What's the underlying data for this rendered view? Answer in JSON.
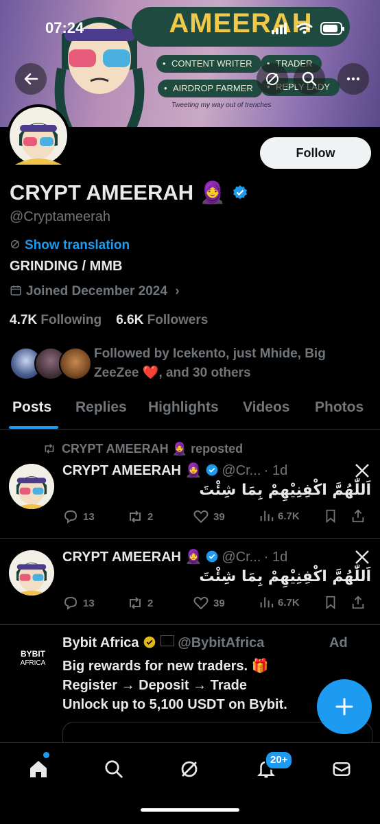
{
  "status": {
    "time": "07:24"
  },
  "banner": {
    "title": "AMEERAH",
    "tags": [
      "CONTENT WRITER",
      "TRADER",
      "AIRDROP FARMER",
      "REPLY LADY"
    ],
    "tagline": "Tweeting my way out of trenches"
  },
  "profile": {
    "name": "CRYPT AMEERAH",
    "name_emoji": "🧕",
    "handle": "@Cryptameerah",
    "show_translation": "Show translation",
    "bio": "GRINDING / MMB",
    "joined": "Joined December 2024",
    "following_count": "4.7K",
    "following_label": "Following",
    "followers_count": "6.6K",
    "followers_label": "Followers",
    "followed_by_1": "Followed by Icekento, just Mhide, Big",
    "followed_by_2": "ZeeZee",
    "followed_by_3": ", and 30 others",
    "follow_button": "Follow"
  },
  "tabs": [
    "Posts",
    "Replies",
    "Highlights",
    "Videos",
    "Photos"
  ],
  "posts": [
    {
      "repost_label": "CRYPT AMEERAH 🧕 reposted",
      "name": "CRYPT AMEERAH 🧕",
      "handle": "@Cr...",
      "time": "· 1d",
      "text": "اَللّٰهُمَّ اكْفِنِيْهِمْ بِمَا شِئْتَ",
      "replies": "13",
      "reposts": "2",
      "likes": "39",
      "views": "6.7K"
    },
    {
      "name": "CRYPT AMEERAH 🧕",
      "handle": "@Cr...",
      "time": "· 1d",
      "text": "اَللّٰهُمَّ اكْفِنِيْهِمْ بِمَا شِئْتَ",
      "replies": "13",
      "reposts": "2",
      "likes": "39",
      "views": "6.7K"
    }
  ],
  "ad": {
    "logo_line1": "BYBIT",
    "logo_line2": "AFRICA",
    "name": "Bybit Africa",
    "handle": "@BybitAfrica",
    "ad_label": "Ad",
    "line1": "Big rewards for new traders. 🎁",
    "line2": "Register → Deposit → Trade",
    "line3": "Unlock up to 5,100 USDT on Bybit."
  },
  "nav": {
    "notifications_badge": "20+"
  },
  "colors": {
    "accent": "#1d9bf0",
    "muted": "#71767b",
    "text": "#e7e9ea"
  }
}
